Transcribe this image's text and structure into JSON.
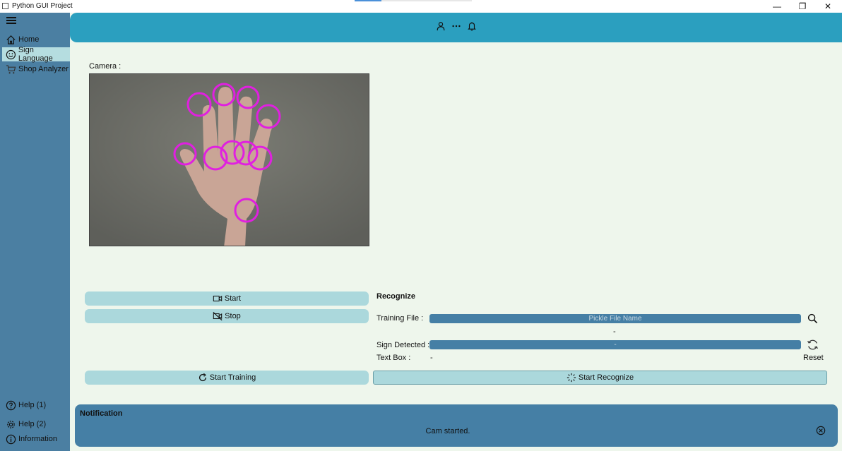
{
  "window": {
    "title": "Python GUI Project",
    "minimize": "—",
    "restore": "❐",
    "close": "✕"
  },
  "sidebar": {
    "items": [
      {
        "label": "Home",
        "icon": "home-icon"
      },
      {
        "label": "Sign Language",
        "icon": "smiley-icon",
        "active": true
      },
      {
        "label": "Shop Analyzer",
        "icon": "cart-icon"
      }
    ],
    "bottom_items": [
      {
        "label": "Help (1)",
        "icon": "question-icon"
      },
      {
        "label": "Help (2)",
        "icon": "gear-icon"
      },
      {
        "label": "Information",
        "icon": "info-icon"
      }
    ]
  },
  "topbar": {
    "icons": [
      "user-icon",
      "more-icon",
      "bell-icon"
    ]
  },
  "camera": {
    "label": "Camera :"
  },
  "buttons": {
    "start": "Start",
    "stop": "Stop",
    "start_training": "Start Training",
    "start_recognize": "Start Recognize"
  },
  "recognize": {
    "title": "Recognize",
    "training_file_label": "Training File :",
    "training_file_placeholder": "Pickle File Name",
    "training_file_status": "-",
    "sign_detected_label": "Sign Detected :",
    "sign_detected_value": "-",
    "text_box_label": "Text Box :",
    "text_box_value": "-",
    "reset_label": "Reset"
  },
  "notification": {
    "title": "Notification",
    "message": "Cam started."
  },
  "colors": {
    "background": "#eef6ec",
    "sidebar": "#4b7fa2",
    "topbar": "#2b9fbf",
    "button": "#abd8dc",
    "field": "#457fa5",
    "landmark": "#e020e0"
  }
}
